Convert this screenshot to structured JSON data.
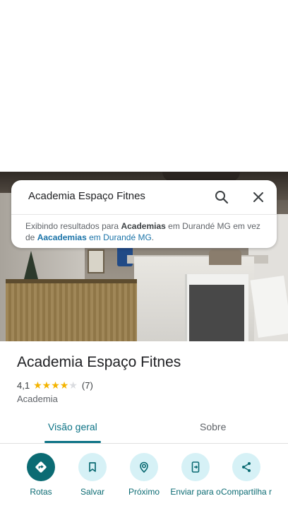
{
  "search": {
    "query": "Academia Espaço Fitnes",
    "notice_prefix": "Exibindo resultados para",
    "notice_term": "Academias",
    "notice_mid": "em Durandé MG em vez de",
    "notice_link_term": "Aacademias",
    "notice_link_rest": "em Durandé MG",
    "notice_end": "."
  },
  "place": {
    "name": "Academia Espaço Fitnes",
    "rating": "4,1",
    "rating_value": 4.1,
    "stars_filled": 4,
    "reviews": "(7)",
    "category": "Academia"
  },
  "tabs": [
    {
      "label": "Visão geral",
      "active": true
    },
    {
      "label": "Sobre",
      "active": false
    }
  ],
  "actions": [
    {
      "label": "Rotas",
      "icon": "directions-icon"
    },
    {
      "label": "Salvar",
      "icon": "bookmark-icon"
    },
    {
      "label": "Próximo",
      "icon": "nearby-icon"
    },
    {
      "label": "Enviar para o",
      "icon": "send-to-phone-icon"
    },
    {
      "label": "Compartilha r",
      "icon": "share-icon"
    }
  ],
  "colors": {
    "accent": "#0b6b73",
    "accent_light": "#d6f1f6",
    "star": "#f4b400",
    "link": "#1a73a8"
  }
}
